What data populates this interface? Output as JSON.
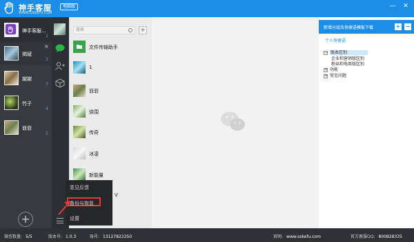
{
  "titlebar": {
    "brand": "神手客服",
    "brand_sub": "WWW.SSKEFU.COM",
    "edition": "电脑版",
    "minimize": "—",
    "close": "✕"
  },
  "accounts": [
    {
      "name": "神手客服...",
      "num": "1"
    },
    {
      "name": "揭斌",
      "num": "2"
    },
    {
      "name": "謝謝",
      "num": "3"
    },
    {
      "name": "竹子",
      "num": "4"
    },
    {
      "name": "菲菲",
      "num": "5"
    }
  ],
  "add_account": "+",
  "search": {
    "placeholder": "搜索"
  },
  "contacts_add": "+",
  "contacts": [
    "文件传输助手",
    "1",
    "菲菲",
    "徐围",
    "传奇",
    "冰凌",
    "新能量",
    "V"
  ],
  "menu": {
    "feedback": "意见反馈",
    "backup": "备份与恢复",
    "settings": "设置"
  },
  "right_panel": {
    "title": "新增分组及快捷语模板下载",
    "link": "个人快捷语",
    "tree": [
      {
        "label": "版本区别",
        "toggle": "−"
      },
      {
        "label": "企业和营销版区别",
        "toggle": ""
      },
      {
        "label": "粉丝和电商版区别",
        "toggle": ""
      },
      {
        "label": "功能",
        "toggle": "+"
      },
      {
        "label": "常见问题",
        "toggle": "+"
      }
    ],
    "add_btn": "+",
    "del_btn": "−"
  },
  "status": {
    "count_label": "微信数量:",
    "count_value": "5/5",
    "version_label": "版本号:",
    "version_value": "1.0.3",
    "account_label": "账号:",
    "account_value": "13127822250",
    "site_label": "官网:",
    "site_value": "www.sskefu.com",
    "qq_label": "官方客服QQ:",
    "qq_value": "800828335"
  },
  "colors": {
    "accent": "#1c8ee8",
    "sidebar": "#373b40",
    "highlight": "#e03b3b"
  }
}
